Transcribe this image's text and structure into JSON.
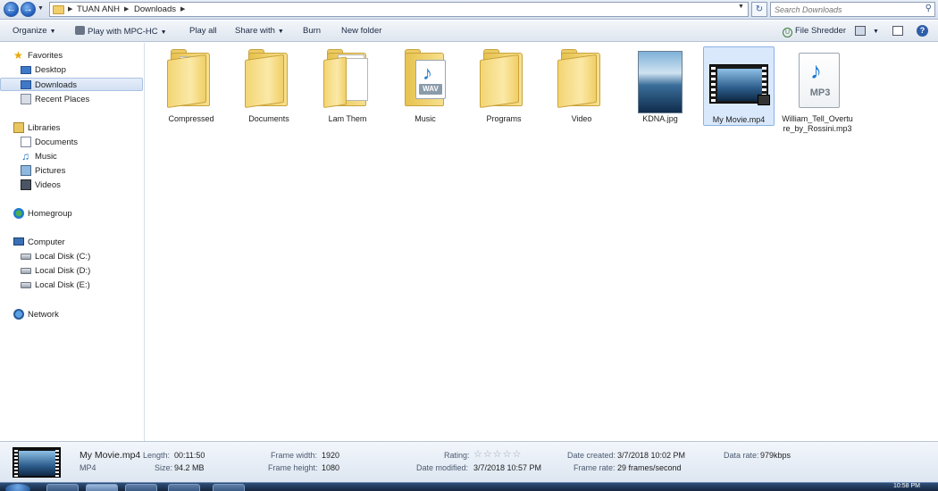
{
  "address_bar": {
    "breadcrumbs": [
      "TUAN ANH",
      "Downloads"
    ],
    "search_placeholder": "Search Downloads"
  },
  "toolbar": {
    "organize": "Organize",
    "play_with": "Play with MPC-HC",
    "play_all": "Play all",
    "share_with": "Share with",
    "burn": "Burn",
    "new_folder": "New folder",
    "file_shredder": "File Shredder"
  },
  "nav": {
    "favorites": "Favorites",
    "desktop": "Desktop",
    "downloads": "Downloads",
    "recent_places": "Recent Places",
    "libraries": "Libraries",
    "documents": "Documents",
    "music": "Music",
    "pictures": "Pictures",
    "videos": "Videos",
    "homegroup": "Homegroup",
    "computer": "Computer",
    "disk_c": "Local Disk (C:)",
    "disk_d": "Local Disk (D:)",
    "disk_e": "Local Disk (E:)",
    "network": "Network"
  },
  "files": [
    {
      "name": "Compressed",
      "type": "folder"
    },
    {
      "name": "Documents",
      "type": "folder"
    },
    {
      "name": "Lam Them",
      "type": "folder"
    },
    {
      "name": "Music",
      "type": "folder"
    },
    {
      "name": "Programs",
      "type": "folder"
    },
    {
      "name": "Video",
      "type": "folder"
    },
    {
      "name": "KDNA.jpg",
      "type": "image"
    },
    {
      "name": "My Movie.mp4",
      "type": "video",
      "selected": true
    },
    {
      "name": "William_Tell_Overture_by_Rossini.mp3",
      "type": "audio"
    }
  ],
  "file_badges": {
    "wav": "WAV",
    "mp3": "MP3"
  },
  "details": {
    "file_name": "My Movie.mp4",
    "file_type": "MP4",
    "length_label": "Length:",
    "length": "00:11:50",
    "size_label": "Size:",
    "size": "94.2 MB",
    "frame_width_label": "Frame width:",
    "frame_width": "1920",
    "frame_height_label": "Frame height:",
    "frame_height": "1080",
    "rating_label": "Rating:",
    "rating_stars": 0,
    "date_modified_label": "Date modified:",
    "date_modified": "3/7/2018 10:57 PM",
    "date_created_label": "Date created:",
    "date_created": "3/7/2018 10:02 PM",
    "frame_rate_label": "Frame rate:",
    "frame_rate": "29 frames/second",
    "data_rate_label": "Data rate:",
    "data_rate": "979kbps"
  },
  "taskbar": {
    "clock": "10:58 PM"
  }
}
